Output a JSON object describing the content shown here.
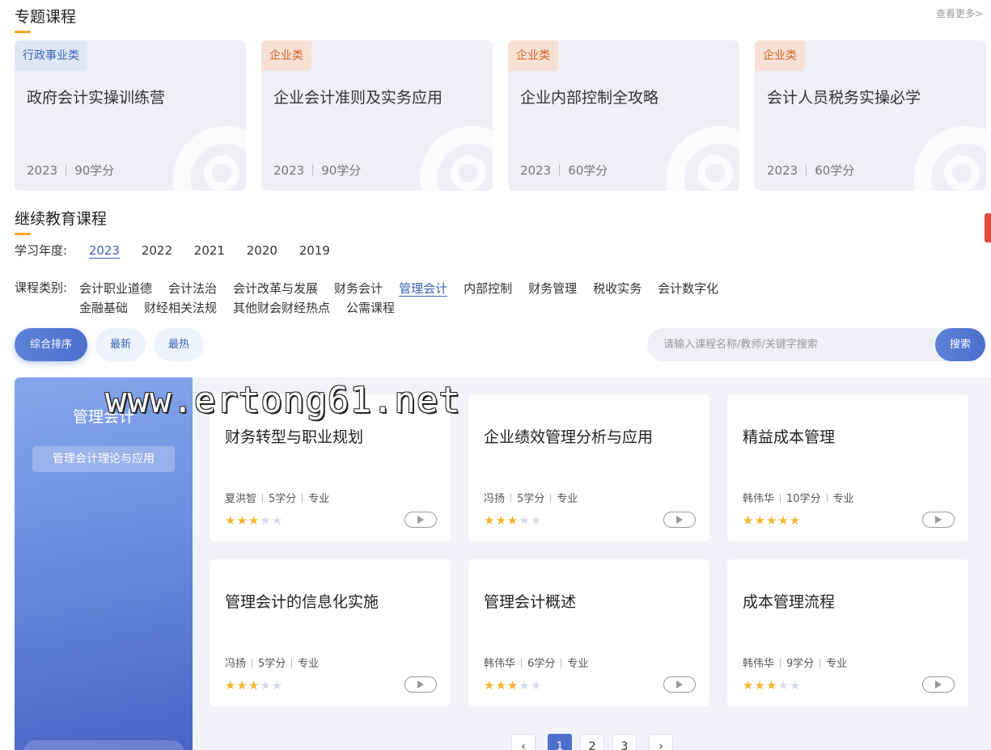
{
  "topics": {
    "title": "专题课程",
    "more": "查看更多>",
    "cards": [
      {
        "tag": "行政事业类",
        "title": "政府会计实操训练营",
        "year": "2023",
        "credits": "90学分"
      },
      {
        "tag": "企业类",
        "title": "企业会计准则及实务应用",
        "year": "2023",
        "credits": "90学分"
      },
      {
        "tag": "企业类",
        "title": "企业内部控制全攻略",
        "year": "2023",
        "credits": "60学分"
      },
      {
        "tag": "企业类",
        "title": "会计人员税务实操必学",
        "year": "2023",
        "credits": "60学分"
      }
    ]
  },
  "ce": {
    "title": "继续教育课程",
    "year_label": "学习年度:",
    "years": [
      "2023",
      "2022",
      "2021",
      "2020",
      "2019"
    ],
    "selected_year": "2023",
    "category_label": "课程类别:",
    "categories": [
      "会计职业道德",
      "会计法治",
      "会计改革与发展",
      "财务会计",
      "管理会计",
      "内部控制",
      "财务管理",
      "税收实务",
      "会计数字化",
      "金融基础",
      "财经相关法规",
      "其他财会财经热点",
      "公需课程"
    ],
    "selected_category": "管理会计"
  },
  "sort": {
    "all": "综合排序",
    "newest": "最新",
    "hottest": "最热"
  },
  "search": {
    "placeholder": "请输入课程名称/教师/关键字搜索",
    "button": "搜索"
  },
  "side": {
    "title": "管理会计",
    "sub": "管理会计理论与应用"
  },
  "courses": [
    {
      "title": "财务转型与职业规划",
      "teacher": "夏洪智",
      "credits": "5学分",
      "type": "专业",
      "rating": 3
    },
    {
      "title": "企业绩效管理分析与应用",
      "teacher": "冯扬",
      "credits": "5学分",
      "type": "专业",
      "rating": 3
    },
    {
      "title": "精益成本管理",
      "teacher": "韩伟华",
      "credits": "10学分",
      "type": "专业",
      "rating": 5
    },
    {
      "title": "管理会计的信息化实施",
      "teacher": "冯扬",
      "credits": "5学分",
      "type": "专业",
      "rating": 3
    },
    {
      "title": "管理会计概述",
      "teacher": "韩伟华",
      "credits": "6学分",
      "type": "专业",
      "rating": 3
    },
    {
      "title": "成本管理流程",
      "teacher": "韩伟华",
      "credits": "9学分",
      "type": "专业",
      "rating": 3
    }
  ],
  "pagination": {
    "prev": "‹",
    "pages": [
      "1",
      "2",
      "3"
    ],
    "current": "1",
    "next": "›"
  },
  "watermark": "www.ertong61.net",
  "colors": {
    "accent": "#4c6fcc",
    "star": "#f5b531",
    "tag_orange": "#d0622a",
    "tag_blue": "#3a63b8"
  }
}
